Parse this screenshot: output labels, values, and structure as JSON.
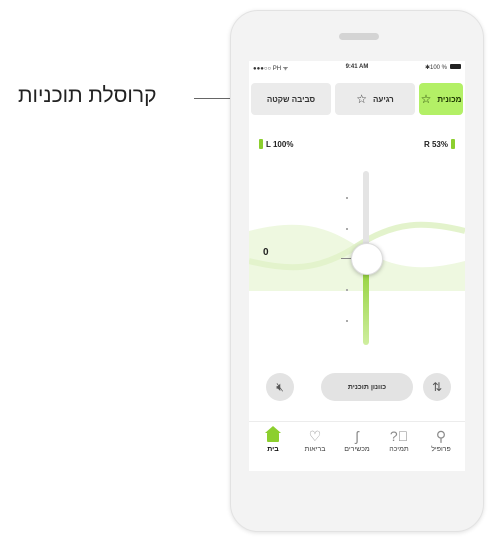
{
  "callout": {
    "label": "קרוסלת תוכניות"
  },
  "status_bar": {
    "carrier": "●●●○○ PH ᯤ",
    "time": "9:41 AM",
    "battery": "✱100 %"
  },
  "programs": [
    {
      "label": "מכונית",
      "icon": "star-icon",
      "active": true
    },
    {
      "label": "רגיעה",
      "icon": "star-icon",
      "active": false
    },
    {
      "label": "סביבה שקטה",
      "icon": null,
      "active": false
    }
  ],
  "levels": {
    "left": "L 100%",
    "right": "R 53%"
  },
  "volume": {
    "value": "0",
    "level_fraction": 0.5
  },
  "controls": {
    "tune_label": "כוונון תוכנית"
  },
  "nav": [
    {
      "label": "פרופיל",
      "icon": "person-icon",
      "active": false
    },
    {
      "label": "תמיכה",
      "icon": "help-icon",
      "active": false
    },
    {
      "label": "מכשירים",
      "icon": "hearing-aid-icon",
      "active": false
    },
    {
      "label": "בריאות",
      "icon": "heart-icon",
      "active": false
    },
    {
      "label": "בית",
      "icon": "home-icon",
      "active": true
    }
  ],
  "colors": {
    "accent": "#b3f066",
    "accent_dark": "#8ccf2e"
  }
}
